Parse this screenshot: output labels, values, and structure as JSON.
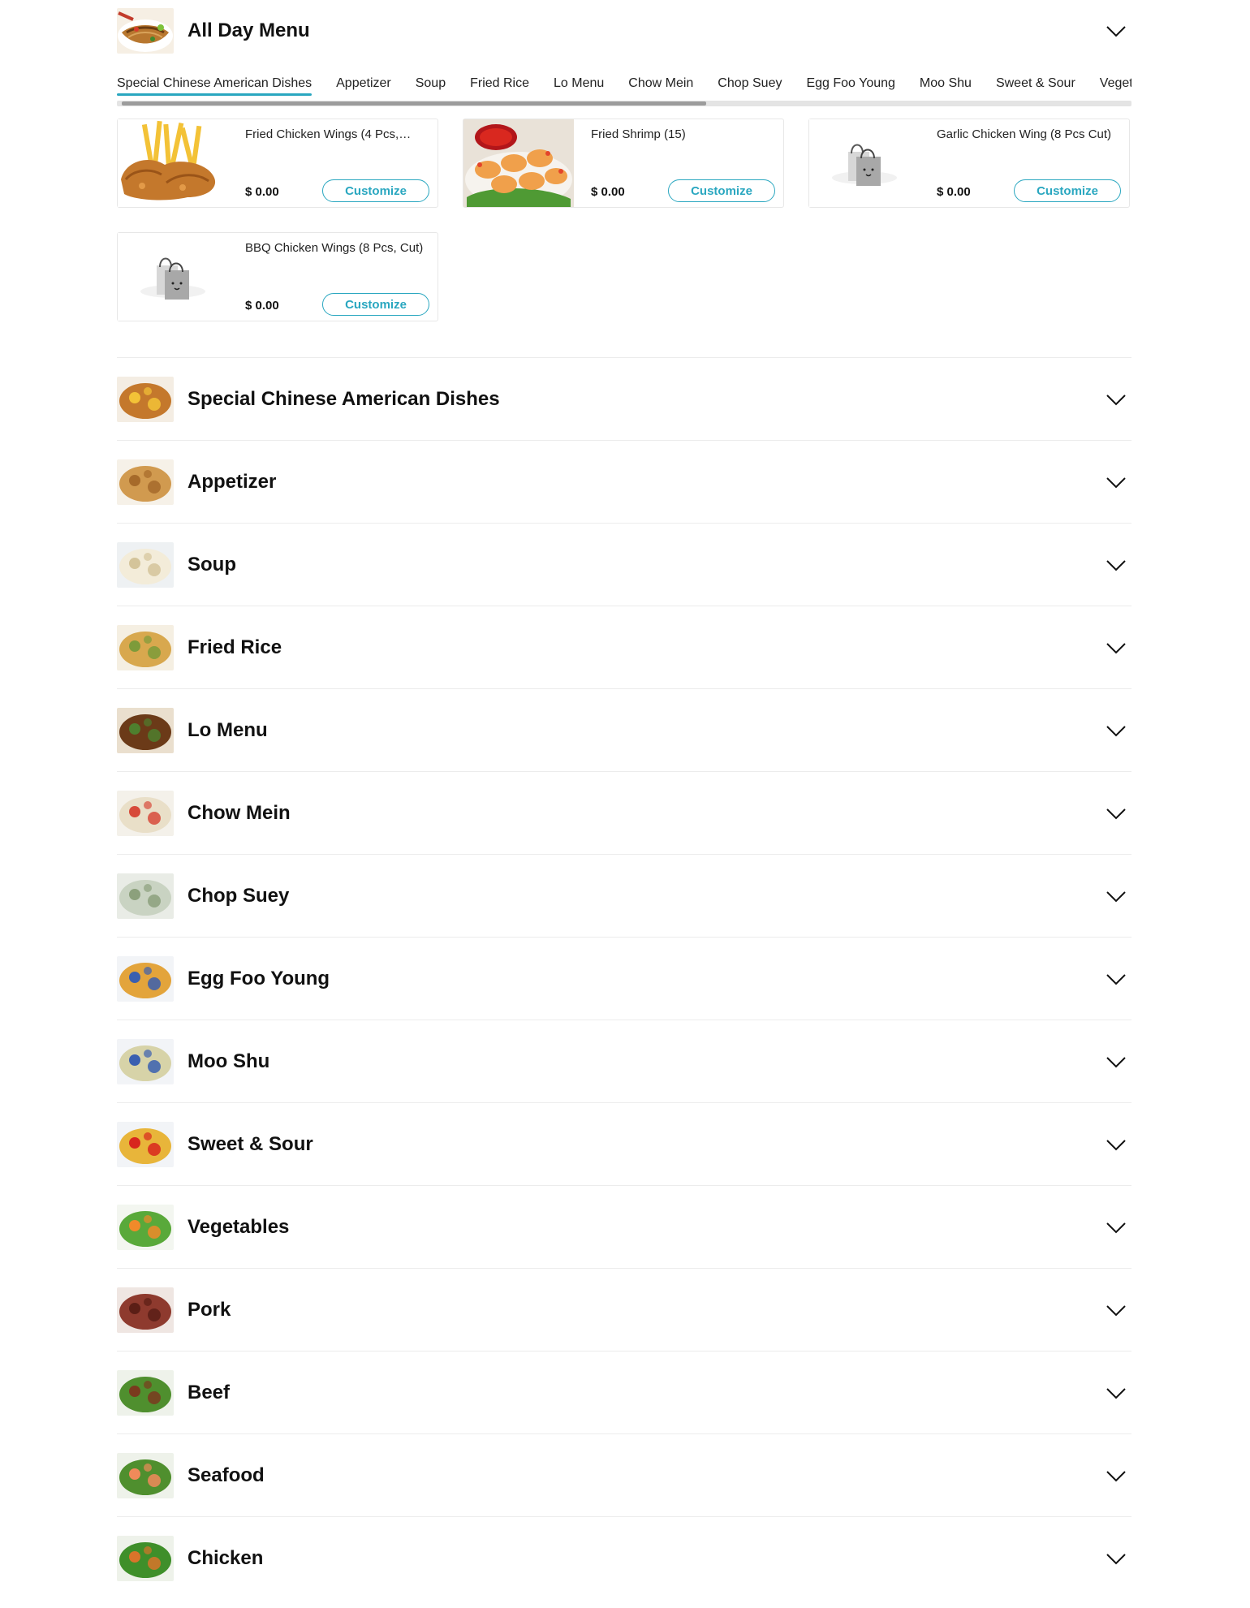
{
  "menu": {
    "title": "All Day Menu",
    "tabs": [
      "Special Chinese American Dishes",
      "Appetizer",
      "Soup",
      "Fried Rice",
      "Lo Menu",
      "Chow Mein",
      "Chop Suey",
      "Egg Foo Young",
      "Moo Shu",
      "Sweet & Sour",
      "Vegetables"
    ],
    "active_tab": "Special Chinese American Dishes",
    "items": [
      {
        "name": "Fried Chicken Wings (4 Pcs,…",
        "price": "$ 0.00",
        "button": "Customize"
      },
      {
        "name": "Fried Shrimp (15)",
        "price": "$ 0.00",
        "button": "Customize"
      },
      {
        "name": "Garlic Chicken Wing (8 Pcs Cut)",
        "price": "$ 0.00",
        "button": "Customize"
      },
      {
        "name": "BBQ Chicken Wings (8 Pcs, Cut)",
        "price": "$ 0.00",
        "button": "Customize"
      }
    ],
    "categories": [
      "Special Chinese American Dishes",
      "Appetizer",
      "Soup",
      "Fried Rice",
      "Lo Menu",
      "Chow Mein",
      "Chop Suey",
      "Egg Foo Young",
      "Moo Shu",
      "Sweet & Sour",
      "Vegetables",
      "Pork",
      "Beef",
      "Seafood",
      "Chicken"
    ]
  },
  "colors": {
    "accent": "#2aa7c0",
    "divider": "#ececec",
    "card_border": "#e7e7e7"
  },
  "icons": {
    "expand": "chevron-down-icon",
    "placeholder": "shopping-bag-icon"
  }
}
